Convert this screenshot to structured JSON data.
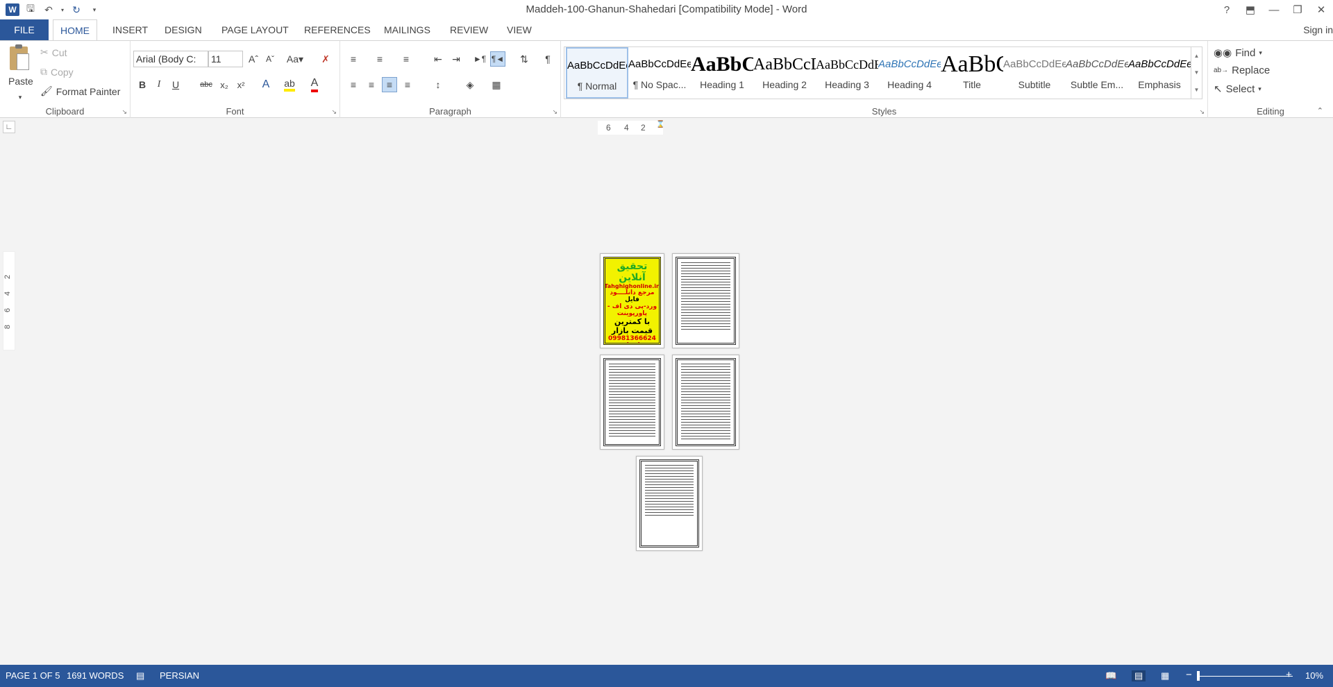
{
  "window": {
    "title": "Maddeh-100-Ghanun-Shahedari [Compatibility Mode] - Word",
    "controls": [
      "?",
      "⬒",
      "—",
      "❐",
      "✕"
    ]
  },
  "qat": {
    "undo_icon": "undo-icon",
    "redo_icon": "redo-icon",
    "save_icon": "save-icon"
  },
  "tabs": [
    "FILE",
    "HOME",
    "INSERT",
    "DESIGN",
    "PAGE LAYOUT",
    "REFERENCES",
    "MAILINGS",
    "REVIEW",
    "VIEW"
  ],
  "active_tab": "HOME",
  "signin": "Sign in",
  "clipboard": {
    "paste": "Paste",
    "cut": "Cut",
    "copy": "Copy",
    "format_painter": "Format Painter",
    "label": "Clipboard"
  },
  "font": {
    "name": "Arial (Body C:",
    "size": "11",
    "label": "Font"
  },
  "paragraph": {
    "label": "Paragraph"
  },
  "styles": {
    "label": "Styles",
    "items": [
      {
        "preview": "AaBbCcDdEe",
        "name": "¶ Normal"
      },
      {
        "preview": "AaBbCcDdEe",
        "name": "¶ No Spac..."
      },
      {
        "preview": "AaBbCcDdEe",
        "name": "Heading 1"
      },
      {
        "preview": "AaBbCcDdEe",
        "name": "Heading 2"
      },
      {
        "preview": "AaBbCcDdEe",
        "name": "Heading 3"
      },
      {
        "preview": "AaBbCcDdEe",
        "name": "Heading 4"
      },
      {
        "preview": "AaBbCcDdEe",
        "name": "Title"
      },
      {
        "preview": "AaBbCcDdEe",
        "name": "Subtitle"
      },
      {
        "preview": "AaBbCcDdEe",
        "name": "Subtle Em..."
      },
      {
        "preview": "AaBbCcDdEe",
        "name": "Emphasis"
      }
    ]
  },
  "editing": {
    "find": "Find",
    "replace": "Replace",
    "select": "Select",
    "label": "Editing"
  },
  "ruler": {
    "h": [
      "6",
      "4",
      "2"
    ],
    "v": [
      "2",
      "4",
      "6",
      "8"
    ]
  },
  "cover": {
    "line1": "تحقیق آنلاین",
    "line2": "Tahghighonline.ir",
    "line3": "مرجع دانلــــود",
    "line4": "فایل",
    "line5": "ورد-پی دی اف - پاورپوینت",
    "line6": "با کمترین قیمت بازار",
    "line7": "09981366624 واتساپ"
  },
  "status": {
    "page": "PAGE 1 OF 5",
    "words": "1691 WORDS",
    "language": "PERSIAN",
    "zoom": "10%"
  }
}
